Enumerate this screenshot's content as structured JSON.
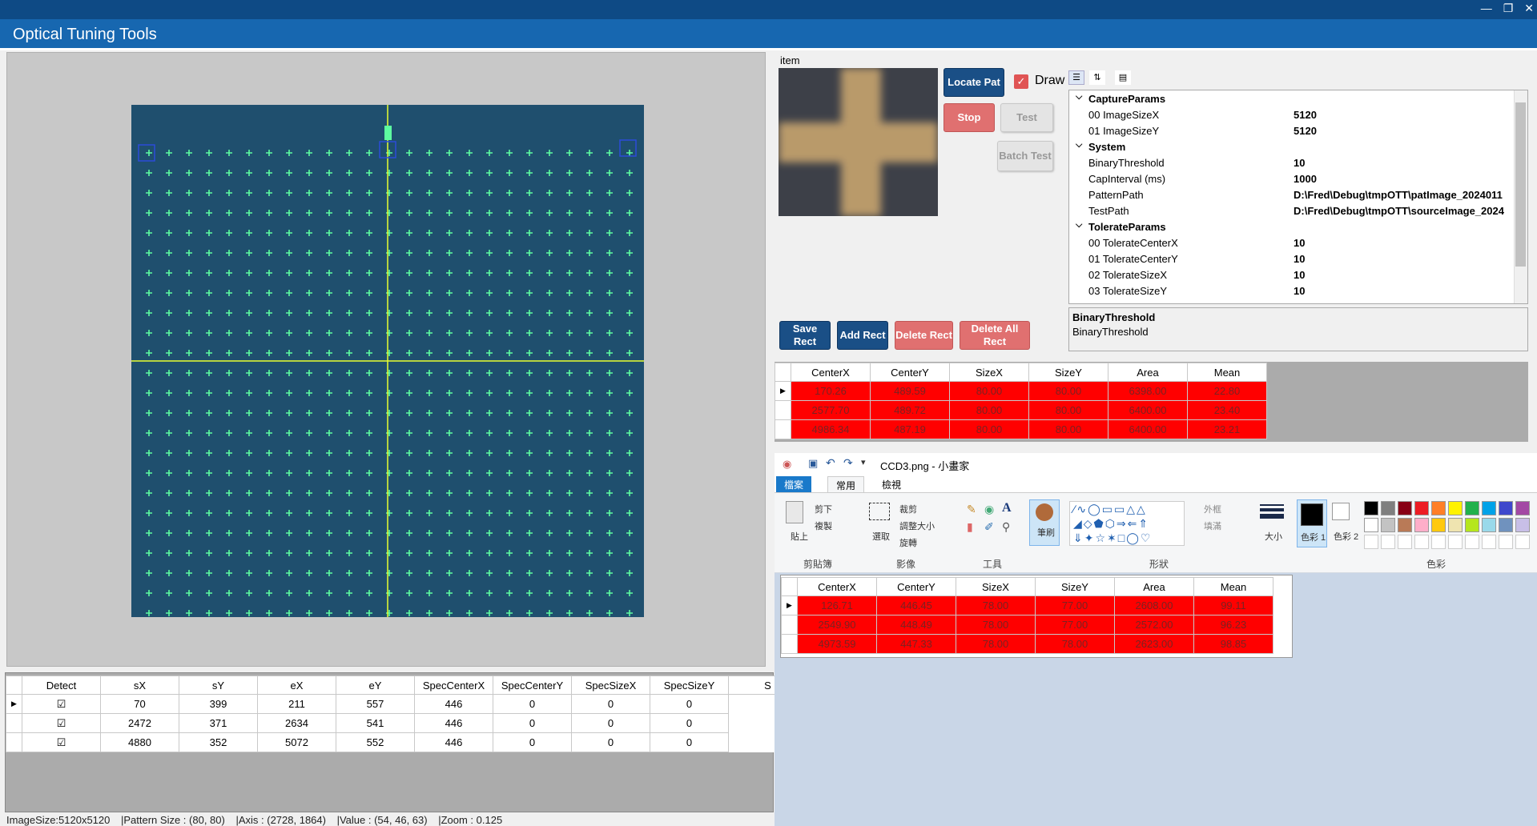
{
  "app": {
    "title": "Optical Tuning Tools"
  },
  "viewer": {
    "marker_color": "#5dfca0",
    "crosshair_color": "#e8ff30"
  },
  "item": {
    "label": "item",
    "buttons": {
      "locate": "Locate Pat",
      "stop": "Stop",
      "test": "Test",
      "batch": "Batch Test",
      "save": "Save Rect",
      "add": "Add Rect",
      "delete": "Delete Rect",
      "delete_all": "Delete All Rect"
    },
    "draw_label": "Draw",
    "draw_checked": true
  },
  "properties": {
    "rows": [
      {
        "type": "cat",
        "key": "CaptureParams"
      },
      {
        "type": "prop",
        "key": "00 ImageSizeX",
        "value": "5120"
      },
      {
        "type": "prop",
        "key": "01 ImageSizeY",
        "value": "5120"
      },
      {
        "type": "cat",
        "key": "System"
      },
      {
        "type": "prop",
        "key": "BinaryThreshold",
        "value": "10"
      },
      {
        "type": "prop",
        "key": "CapInterval (ms)",
        "value": "1000"
      },
      {
        "type": "prop",
        "key": "PatternPath",
        "value": "D:\\Fred\\Debug\\tmpOTT\\patImage_2024011"
      },
      {
        "type": "prop",
        "key": "TestPath",
        "value": "D:\\Fred\\Debug\\tmpOTT\\sourceImage_2024"
      },
      {
        "type": "cat",
        "key": "TolerateParams"
      },
      {
        "type": "prop",
        "key": "00 TolerateCenterX",
        "value": "10"
      },
      {
        "type": "prop",
        "key": "01 TolerateCenterY",
        "value": "10"
      },
      {
        "type": "prop",
        "key": "02 TolerateSizeX",
        "value": "10"
      },
      {
        "type": "prop",
        "key": "03 TolerateSizeY",
        "value": "10"
      }
    ],
    "desc_title": "BinaryThreshold",
    "desc_text": "BinaryThreshold"
  },
  "result1": {
    "headers": [
      "CenterX",
      "CenterY",
      "SizeX",
      "SizeY",
      "Area",
      "Mean"
    ],
    "rows": [
      [
        "170.26",
        "489.59",
        "80.00",
        "80.00",
        "6398.00",
        "22.80"
      ],
      [
        "2577.70",
        "489.72",
        "80.00",
        "80.00",
        "6400.00",
        "23.40"
      ],
      [
        "4986.34",
        "487.19",
        "80.00",
        "80.00",
        "6400.00",
        "23.21"
      ]
    ]
  },
  "detect": {
    "headers": [
      "Detect",
      "sX",
      "sY",
      "eX",
      "eY",
      "SpecCenterX",
      "SpecCenterY",
      "SpecSizeX",
      "SpecSizeY",
      "S"
    ],
    "rows": [
      [
        "☑",
        "70",
        "399",
        "211",
        "557",
        "446",
        "0",
        "0",
        "0"
      ],
      [
        "☑",
        "2472",
        "371",
        "2634",
        "541",
        "446",
        "0",
        "0",
        "0"
      ],
      [
        "☑",
        "4880",
        "352",
        "5072",
        "552",
        "446",
        "0",
        "0",
        "0"
      ]
    ]
  },
  "status": {
    "image_size": "ImageSize:5120x5120",
    "pattern_size": "|Pattern Size : (80, 80)",
    "axis": "|Axis : (2728, 1864)",
    "value": "|Value : (54, 46, 63)",
    "zoom": "|Zoom : 0.125"
  },
  "paint": {
    "title": "CCD3.png - 小畫家",
    "tabs": [
      "檔案",
      "常用",
      "檢視"
    ],
    "groups": [
      "剪貼簿",
      "影像",
      "工具",
      "形狀",
      "色彩"
    ],
    "labels": {
      "cut": "剪下",
      "copy": "複製",
      "paste": "貼上",
      "crop": "裁剪",
      "resize": "調整大小",
      "rotate": "旋轉",
      "select": "選取",
      "brush": "筆刷",
      "outline": "外框",
      "fill": "填滿",
      "size": "大小",
      "color1": "色彩 1",
      "color2": "色彩 2"
    },
    "palette": [
      "#000000",
      "#7f7f7f",
      "#880015",
      "#ed1c24",
      "#ff7f27",
      "#fff200",
      "#22b14c",
      "#00a2e8",
      "#3f48cc",
      "#a349a4",
      "#ffffff",
      "#c3c3c3",
      "#b97a57",
      "#ffaec9",
      "#ffc90e",
      "#efe4b0",
      "#b5e61d",
      "#99d9ea",
      "#7092be",
      "#c8bfe7"
    ]
  },
  "result2": {
    "headers": [
      "CenterX",
      "CenterY",
      "SizeX",
      "SizeY",
      "Area",
      "Mean"
    ],
    "rows": [
      [
        "126.71",
        "446.45",
        "78.00",
        "77.00",
        "2608.00",
        "99.11"
      ],
      [
        "2549.90",
        "448.49",
        "78.00",
        "77.00",
        "2572.00",
        "96.23"
      ],
      [
        "4973.59",
        "447.33",
        "78.00",
        "78.00",
        "2623.00",
        "98.85"
      ]
    ]
  }
}
